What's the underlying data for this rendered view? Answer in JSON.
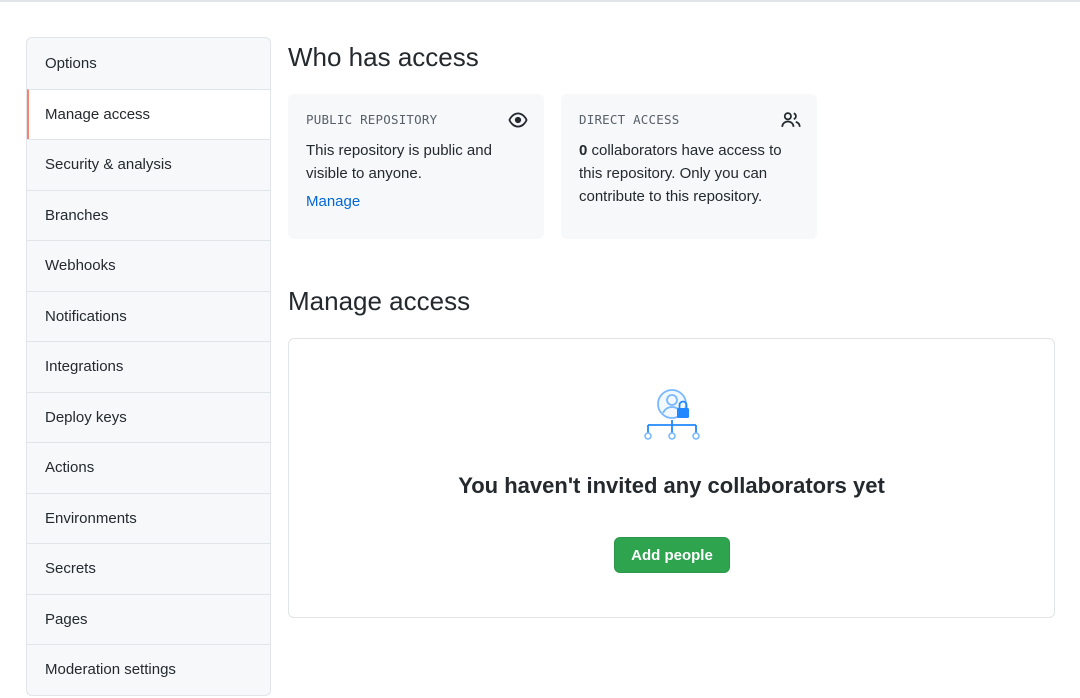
{
  "sidebar": {
    "items": [
      {
        "label": "Options"
      },
      {
        "label": "Manage access"
      },
      {
        "label": "Security & analysis"
      },
      {
        "label": "Branches"
      },
      {
        "label": "Webhooks"
      },
      {
        "label": "Notifications"
      },
      {
        "label": "Integrations"
      },
      {
        "label": "Deploy keys"
      },
      {
        "label": "Actions"
      },
      {
        "label": "Environments"
      },
      {
        "label": "Secrets"
      },
      {
        "label": "Pages"
      },
      {
        "label": "Moderation settings"
      }
    ],
    "selected": "Manage access",
    "accent_color": "#f9826c"
  },
  "who_has_access": {
    "title": "Who has access",
    "public_card": {
      "label": "PUBLIC REPOSITORY",
      "icon": "eye-icon",
      "text": "This repository is public and visible to anyone.",
      "link": "Manage"
    },
    "direct_card": {
      "label": "DIRECT ACCESS",
      "icon": "people-icon",
      "count": "0",
      "text": " collaborators have access to this repository. Only you can contribute to this repository."
    }
  },
  "manage_access": {
    "title": "Manage access",
    "empty_icon": "collaborators-lock-icon",
    "empty_heading": "You haven't invited any collaborators yet",
    "add_button": "Add people",
    "button_color": "#2ea44f"
  }
}
